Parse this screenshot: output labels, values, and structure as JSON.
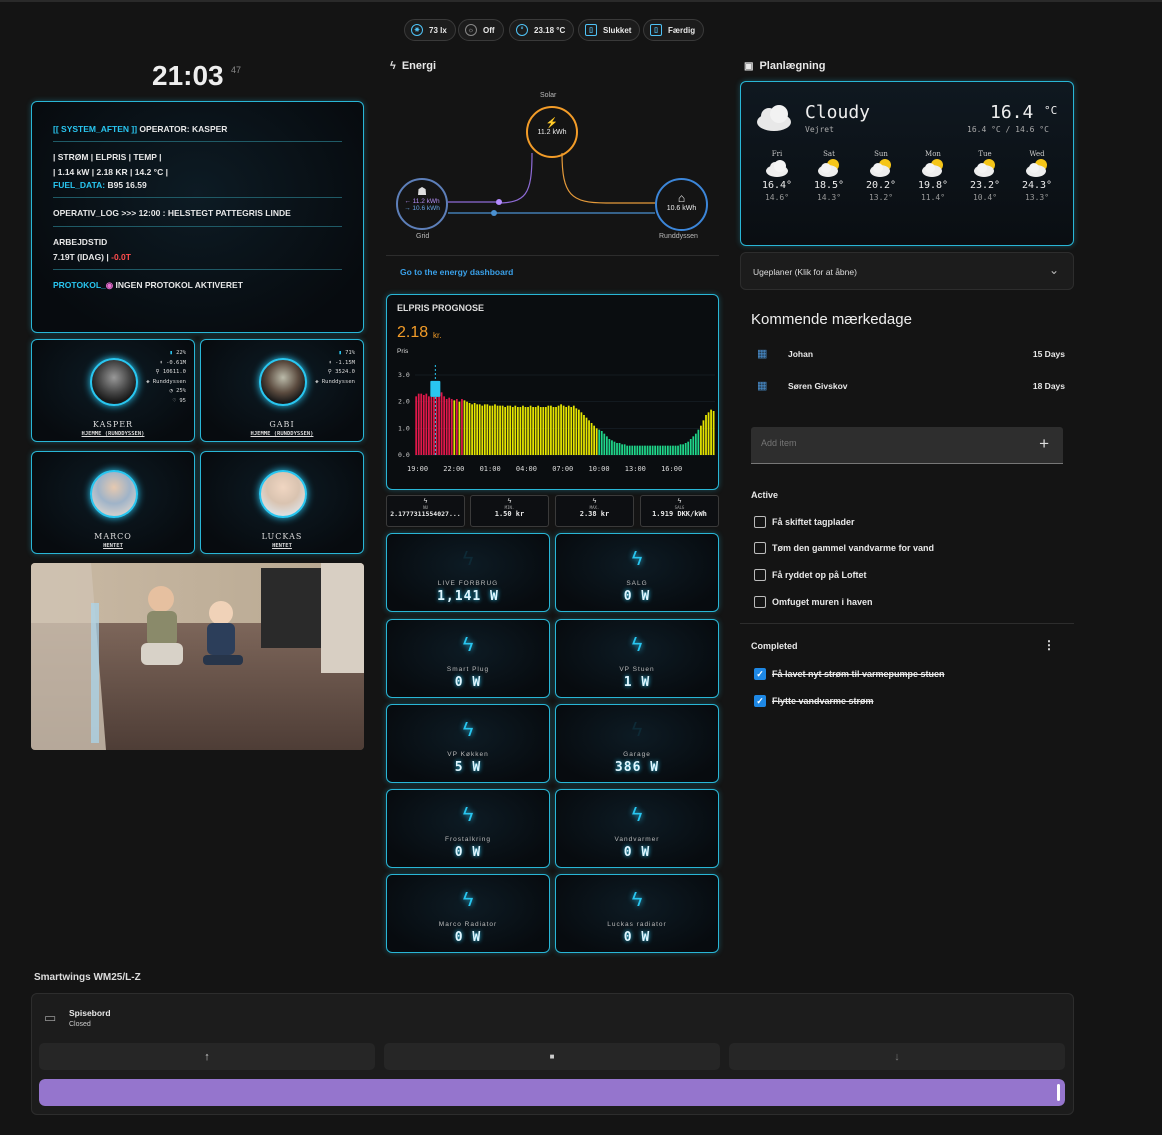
{
  "chips": [
    {
      "icon": "brightness-icon",
      "label": "73 lx"
    },
    {
      "icon": "sun-icon",
      "label": "Off"
    },
    {
      "icon": "temperature-icon",
      "label": "23.18 °C"
    },
    {
      "icon": "device-icon",
      "label": "Slukket"
    },
    {
      "icon": "status-icon",
      "label": "Færdig"
    }
  ],
  "clock": {
    "time": "21:03",
    "seconds": "47"
  },
  "system": {
    "line1a": "[[ SYSTEM_AFTEN ]]",
    "line1b": " OPERATOR: KASPER",
    "line2": "| STRØM | ELPRIS | TEMP |",
    "line3": "| 1.14 kW | 2.18 KR | 14.2 °C |",
    "fuel_label": "FUEL_DATA:",
    "fuel_value": " B95 16.59",
    "oplog": "OPERATIV_LOG >>> 12:00 : HELSTEGT PATTEGRIS LINDE",
    "worktime_label": "ARBEJDSTID",
    "worktime_value": "7.19T (IDAG) | ",
    "worktime_delta": "-0.0T",
    "protocol_label": "PROTOKOL_",
    "protocol_value": " INGEN PROTOKOL AKTIVERET"
  },
  "people": [
    {
      "name": "KASPER",
      "location": "HJEMME (RUNDDYSSEN)",
      "stats": [
        "22%",
        "-0.61M",
        "10611.0",
        "Runddyssen",
        "25%",
        "95"
      ]
    },
    {
      "name": "GABI",
      "location": "HJEMME (RUNDDYSSEN)",
      "stats": [
        "71%",
        "-1.15M",
        "3524.0",
        "Runddyssen"
      ]
    },
    {
      "name": "MARCO",
      "location": "HENTET"
    },
    {
      "name": "LUCKAS",
      "location": "HENTET"
    }
  ],
  "energy": {
    "title": "Energi",
    "solar_label": "Solar",
    "solar_value": "11.2 kWh",
    "grid_label": "Grid",
    "grid_in": "← 11.2 kWh",
    "grid_out": "→ 10.6 kWh",
    "home_label": "Runddyssen",
    "home_value": "10.6 kWh",
    "dashboard_link": "Go to the energy dashboard"
  },
  "elpris": {
    "title": "ELPRIS PROGNOSE",
    "current": "2.18",
    "unit": "kr.",
    "sublabel": "Pris",
    "colors": {
      "high": "#e0184a",
      "mid": "#e6e600",
      "low": "#1fd68a"
    }
  },
  "chart_data": {
    "type": "bar",
    "title": "ELPRIS PROGNOSE",
    "ylabel": "Pris",
    "ylim": [
      0,
      3.0
    ],
    "yticks": [
      "3.0",
      "2.0",
      "1.0",
      "0.0"
    ],
    "xticks": [
      "19:00",
      "22:00",
      "01:00",
      "04:00",
      "07:00",
      "10:00",
      "13:00",
      "16:00"
    ],
    "values": [
      2.2,
      2.3,
      2.3,
      2.25,
      2.3,
      2.2,
      2.3,
      2.4,
      2.35,
      2.3,
      2.35,
      2.2,
      2.1,
      2.15,
      2.1,
      2.05,
      2.1,
      2.0,
      2.1,
      2.05,
      2.0,
      1.95,
      1.9,
      1.95,
      1.9,
      1.9,
      1.85,
      1.9,
      1.9,
      1.85,
      1.85,
      1.9,
      1.85,
      1.85,
      1.85,
      1.8,
      1.85,
      1.85,
      1.8,
      1.85,
      1.8,
      1.8,
      1.85,
      1.8,
      1.8,
      1.85,
      1.8,
      1.8,
      1.85,
      1.8,
      1.8,
      1.8,
      1.85,
      1.85,
      1.8,
      1.8,
      1.85,
      1.9,
      1.85,
      1.8,
      1.85,
      1.8,
      1.85,
      1.75,
      1.7,
      1.6,
      1.5,
      1.4,
      1.3,
      1.2,
      1.1,
      1.0,
      0.95,
      0.9,
      0.8,
      0.7,
      0.6,
      0.55,
      0.5,
      0.45,
      0.45,
      0.4,
      0.4,
      0.35,
      0.35,
      0.35,
      0.35,
      0.35,
      0.35,
      0.35,
      0.35,
      0.35,
      0.35,
      0.35,
      0.35,
      0.35,
      0.35,
      0.35,
      0.35,
      0.35,
      0.35,
      0.35,
      0.35,
      0.35,
      0.4,
      0.4,
      0.45,
      0.5,
      0.6,
      0.7,
      0.8,
      0.95,
      1.1,
      1.3,
      1.5,
      1.6,
      1.7,
      1.65
    ],
    "current_marker": "2.18"
  },
  "price_stats": [
    {
      "title": "NU",
      "value": "2.1777311554027..."
    },
    {
      "title": "MIN.",
      "value": "1.50 kr"
    },
    {
      "title": "MAX.",
      "value": "2.38 kr"
    },
    {
      "title": "SALG",
      "value": "1.919 DKK/kWh"
    }
  ],
  "power": [
    {
      "label": "LIVE FORBRUG",
      "value": "1,141 W",
      "dim": true
    },
    {
      "label": "SALG",
      "value": "0 W"
    },
    {
      "label": "Smart Plug",
      "value": "0 W"
    },
    {
      "label": "VP Stuen",
      "value": "1 W"
    },
    {
      "label": "VP Køkken",
      "value": "5 W"
    },
    {
      "label": "Garage",
      "value": "386 W",
      "dim": true
    },
    {
      "label": "Frostalkring",
      "value": "0 W"
    },
    {
      "label": "Vandvarmer",
      "value": "0 W"
    },
    {
      "label": "Marco Radiator",
      "value": "0 W"
    },
    {
      "label": "Luckas radiator",
      "value": "0 W"
    }
  ],
  "planning": {
    "title": "Planlægning"
  },
  "weather": {
    "condition": "Cloudy",
    "sublabel": "Vejret",
    "temp": "16.4",
    "unit": "°C",
    "range": "16.4 °C / 14.6 °C",
    "forecast": [
      {
        "day": "Fri",
        "icon": "cloud-icon",
        "high": "16.4°",
        "low": "14.6°"
      },
      {
        "day": "Sat",
        "icon": "partly-cloudy-icon",
        "high": "18.5°",
        "low": "14.3°"
      },
      {
        "day": "Sun",
        "icon": "partly-cloudy-icon",
        "high": "20.2°",
        "low": "13.2°"
      },
      {
        "day": "Mon",
        "icon": "partly-cloudy-icon",
        "high": "19.8°",
        "low": "11.4°"
      },
      {
        "day": "Tue",
        "icon": "partly-cloudy-icon",
        "high": "23.2°",
        "low": "10.4°"
      },
      {
        "day": "Wed",
        "icon": "partly-cloudy-icon",
        "high": "24.3°",
        "low": "13.3°"
      }
    ]
  },
  "weekplans": {
    "label": "Ugeplaner (Klik for at åbne)"
  },
  "birthdays": {
    "title": "Kommende mærkedage",
    "items": [
      {
        "name": "Johan",
        "days": "15 Days"
      },
      {
        "name": "Søren Givskov",
        "days": "18 Days"
      }
    ]
  },
  "todo": {
    "placeholder": "Add item",
    "active_title": "Active",
    "active": [
      "Få skiftet tagplader",
      "Tøm den gammel vandvarme for vand",
      "Få ryddet op på Loftet",
      "Omfuget muren i haven"
    ],
    "completed_title": "Completed",
    "completed": [
      "Få lavet nyt strøm til varmepumpe stuen",
      "Flytte vandvarme strøm"
    ]
  },
  "cover": {
    "section_title": "Smartwings WM25/L-Z",
    "name": "Spisebord",
    "state": "Closed",
    "up": "↑",
    "stop": "■",
    "down": "↓",
    "position_percent": 100,
    "bar_color": "#9575cd"
  }
}
